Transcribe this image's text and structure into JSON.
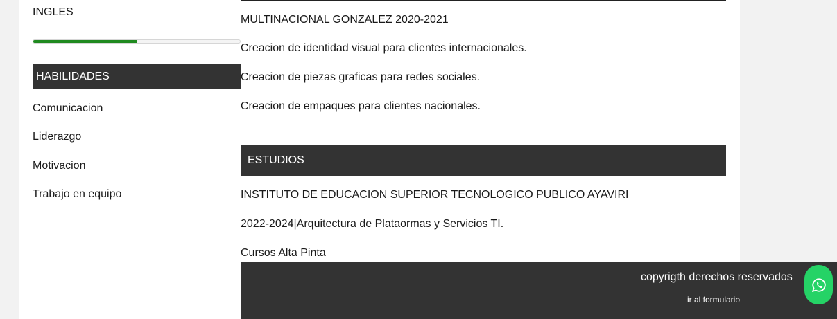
{
  "languages": {
    "label": "INGLES",
    "level_percent": 50
  },
  "skills": {
    "title": "HABILIDADES",
    "items": [
      "Comunicacion",
      "Liderazgo",
      "Motivacion",
      "Trabajo en equipo"
    ]
  },
  "experience": {
    "company": "MULTINACIONAL GONZALEZ 2020-2021",
    "tasks": [
      "Creacion de identidad visual para clientes internacionales.",
      "Creacion de piezas graficas para redes sociales.",
      "Creacion de empaques para clientes nacionales."
    ]
  },
  "studies": {
    "title": "ESTUDIOS",
    "institution": "INSTITUTO DE EDUCACION SUPERIOR TECNOLOGICO PUBLICO AYAVIRI",
    "period_program": "2022-2024|Arquitectura de Plataormas y Servicios TI.",
    "course": "Cursos Alta Pinta"
  },
  "footer": {
    "copyright": "copyrigth derechos reservados",
    "form_link": "ir al formulario"
  },
  "floating": {
    "icon": "whatsapp-icon",
    "color": "#25d366"
  }
}
